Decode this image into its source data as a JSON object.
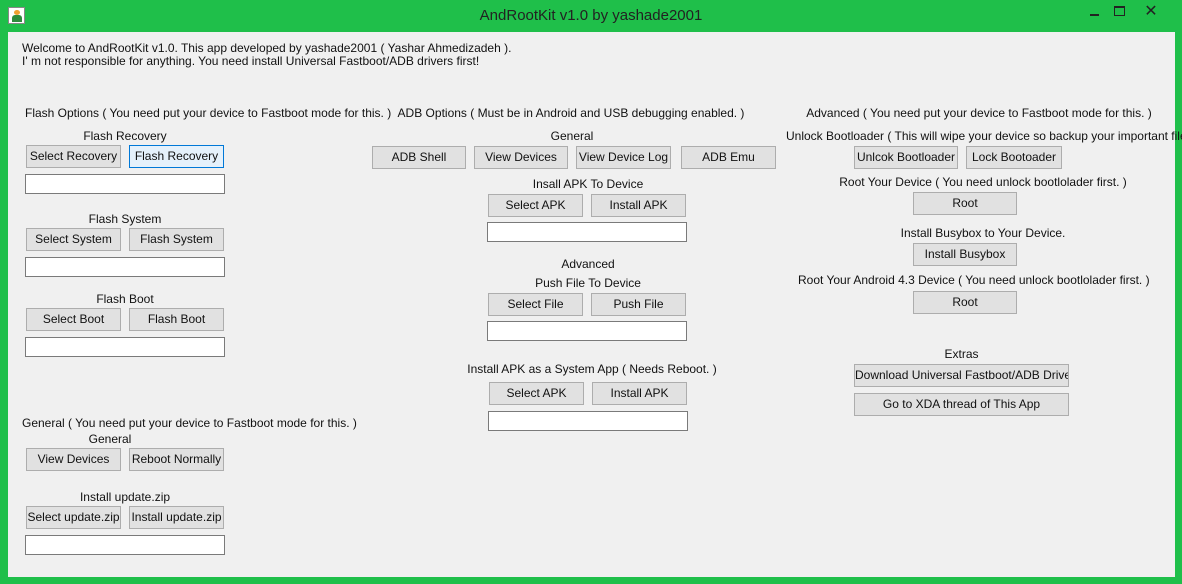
{
  "window": {
    "title": "AndRootKit v1.0 by yashade2001",
    "close_glyph": "✕"
  },
  "welcome": {
    "line1": "Welcome to AndRootKit v1.0. This app developed by yashade2001 ( Yashar Ahmedizadeh ).",
    "line2": "I' m not responsible for anything. You need install Universal Fastboot/ADB drivers first!"
  },
  "flash": {
    "heading": "Flash Options ( You need put your device to Fastboot mode for this. )",
    "recovery": {
      "label": "Flash Recovery",
      "select": "Select Recovery",
      "flash": "Flash Recovery",
      "path": ""
    },
    "system": {
      "label": "Flash System",
      "select": "Select System",
      "flash": "Flash System",
      "path": ""
    },
    "boot": {
      "label": "Flash Boot",
      "select": "Select Boot",
      "flash": "Flash Boot",
      "path": ""
    }
  },
  "general": {
    "heading": "General ( You need put your device to Fastboot mode for this. )",
    "sub": "General",
    "view_devices": "View Devices",
    "reboot": "Reboot Normally",
    "update": {
      "label": "Install update.zip",
      "select": "Select update.zip",
      "install": "Install update.zip",
      "path": ""
    }
  },
  "adb": {
    "heading": "ADB Options ( Must be in Android and USB debugging enabled. )",
    "general_label": "General",
    "shell": "ADB Shell",
    "view_devices": "View Devices",
    "view_log": "View Device Log",
    "emu": "ADB Emu",
    "install_apk": {
      "label": "Insall APK To Device",
      "select": "Select APK",
      "install": "Install APK",
      "path": ""
    },
    "advanced_label": "Advanced",
    "push": {
      "label": "Push File To Device",
      "select": "Select File",
      "push": "Push File",
      "path": ""
    },
    "system_app": {
      "label": "Install APK as a System App ( Needs Reboot. )",
      "select": "Select APK",
      "install": "Install APK",
      "path": ""
    }
  },
  "advanced": {
    "heading": "Advanced ( You need put your device to Fastboot mode for this. )",
    "bootloader": {
      "label": "Unlock Bootloader ( This will wipe your device so backup your important files first. )",
      "unlock": "Unlcok Bootloader",
      "lock": "Lock Bootoader"
    },
    "root": {
      "label": "Root Your Device  ( You need unlock bootlolader first. )",
      "button": "Root"
    },
    "busybox": {
      "label": "Install Busybox to Your Device.",
      "button": "Install Busybox"
    },
    "root43": {
      "label": "Root Your Android 4.3 Device  ( You need unlock bootlolader first. )",
      "button": "Root"
    },
    "extras": {
      "label": "Extras",
      "download": "Download Universal Fastboot/ADB Drivers",
      "xda": "Go to XDA thread of This App"
    }
  }
}
